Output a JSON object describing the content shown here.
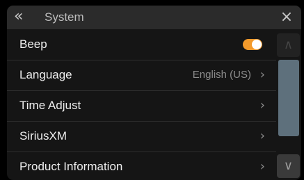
{
  "header": {
    "back_glyph": "«",
    "title": "System",
    "close_glyph": "×"
  },
  "list": {
    "items": [
      {
        "label": "Beep",
        "control": "toggle",
        "toggle_on": true
      },
      {
        "label": "Language",
        "value": "English (US)",
        "chevron": "›"
      },
      {
        "label": "Time Adjust",
        "chevron": "›"
      },
      {
        "label": "SiriusXM",
        "chevron": "›"
      },
      {
        "label": "Product Information",
        "chevron": "›"
      }
    ]
  },
  "scrollbar": {
    "up_glyph": "∧",
    "down_glyph": "∨"
  },
  "colors": {
    "accent": "#f39a2b",
    "scroll_thumb": "#5e707c"
  }
}
